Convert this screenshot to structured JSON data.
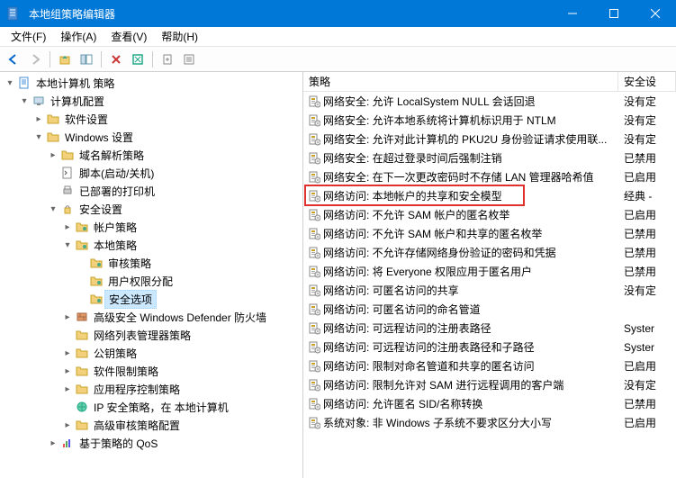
{
  "window": {
    "title": "本地组策略编辑器"
  },
  "menu": {
    "file": "文件(F)",
    "action": "操作(A)",
    "view": "查看(V)",
    "help": "帮助(H)"
  },
  "toolbar": {
    "back": "←",
    "forward": "→",
    "up": "📁",
    "list": "☰",
    "delete": "✖",
    "refresh": "↻",
    "export": "📤",
    "props": "📋"
  },
  "tree": {
    "root": "本地计算机 策略",
    "computer": "计算机配置",
    "software": "软件设置",
    "windows": "Windows 设置",
    "dns": "域名解析策略",
    "scripts": "脚本(启动/关机)",
    "printers": "已部署的打印机",
    "security": "安全设置",
    "account_policy": "帐户策略",
    "local_policy": "本地策略",
    "audit": "审核策略",
    "user_rights": "用户权限分配",
    "sec_options": "安全选项",
    "defender": "高级安全 Windows Defender 防火墙",
    "netlist": "网络列表管理器策略",
    "pubkey": "公钥策略",
    "software_restrict": "软件限制策略",
    "app_control": "应用程序控制策略",
    "ipsec": "IP 安全策略，在 本地计算机",
    "adv_audit": "高级审核策略配置",
    "qos": "基于策略的 QoS"
  },
  "columns": {
    "policy": "策略",
    "setting": "安全设"
  },
  "rows": [
    {
      "p": "网络安全: 允许 LocalSystem NULL 会话回退",
      "s": "没有定"
    },
    {
      "p": "网络安全: 允许本地系统将计算机标识用于 NTLM",
      "s": "没有定"
    },
    {
      "p": "网络安全: 允许对此计算机的 PKU2U 身份验证请求使用联...",
      "s": "没有定"
    },
    {
      "p": "网络安全: 在超过登录时间后强制注销",
      "s": "已禁用"
    },
    {
      "p": "网络安全: 在下一次更改密码时不存储 LAN 管理器哈希值",
      "s": "已启用"
    },
    {
      "p": "网络访问: 本地帐户的共享和安全模型",
      "s": "经典 - "
    },
    {
      "p": "网络访问: 不允许 SAM 帐户的匿名枚举",
      "s": "已启用"
    },
    {
      "p": "网络访问: 不允许 SAM 帐户和共享的匿名枚举",
      "s": "已禁用"
    },
    {
      "p": "网络访问: 不允许存储网络身份验证的密码和凭据",
      "s": "已禁用"
    },
    {
      "p": "网络访问: 将 Everyone 权限应用于匿名用户",
      "s": "已禁用"
    },
    {
      "p": "网络访问: 可匿名访问的共享",
      "s": "没有定"
    },
    {
      "p": "网络访问: 可匿名访问的命名管道",
      "s": ""
    },
    {
      "p": "网络访问: 可远程访问的注册表路径",
      "s": "Syster"
    },
    {
      "p": "网络访问: 可远程访问的注册表路径和子路径",
      "s": "Syster"
    },
    {
      "p": "网络访问: 限制对命名管道和共享的匿名访问",
      "s": "已启用"
    },
    {
      "p": "网络访问: 限制允许对 SAM 进行远程调用的客户端",
      "s": "没有定"
    },
    {
      "p": "网络访问: 允许匿名 SID/名称转换",
      "s": "已禁用"
    },
    {
      "p": "系统对象: 非 Windows 子系统不要求区分大小写",
      "s": "已启用"
    }
  ]
}
